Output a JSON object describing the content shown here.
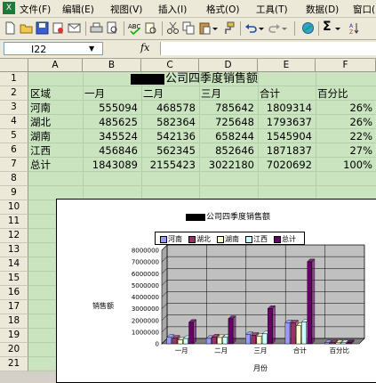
{
  "menu": {
    "items": [
      "文件(F)",
      "编辑(E)",
      "视图(V)",
      "插入(I)",
      "格式(O)",
      "工具(T)",
      "数据(D)",
      "窗口("
    ]
  },
  "formula_bar": {
    "name_box": "I22",
    "fx": "fx",
    "value": ""
  },
  "columns": [
    "A",
    "B",
    "C",
    "D",
    "E",
    "F"
  ],
  "rows": [
    "1",
    "2",
    "3",
    "4",
    "5",
    "6",
    "7",
    "8",
    "9",
    "10",
    "11",
    "12",
    "13",
    "14",
    "15",
    "16",
    "17",
    "18",
    "19",
    "20",
    "21"
  ],
  "sheet": {
    "title_suffix": "公司四季度销售额",
    "header": [
      "区域",
      "一月",
      "二月",
      "三月",
      "合计",
      "百分比"
    ],
    "data": [
      [
        "河南",
        "555094",
        "468578",
        "785642",
        "1809314",
        "26%"
      ],
      [
        "湖北",
        "485625",
        "582364",
        "725648",
        "1793637",
        "26%"
      ],
      [
        "湖南",
        "345524",
        "542136",
        "658244",
        "1545904",
        "22%"
      ],
      [
        "江西",
        "456846",
        "562345",
        "852646",
        "1871837",
        "27%"
      ],
      [
        "总计",
        "1843089",
        "2155423",
        "3022180",
        "7020692",
        "100%"
      ]
    ]
  },
  "chart_data": {
    "type": "bar",
    "title": "公司四季度销售额",
    "xlabel": "月份",
    "ylabel": "销售额",
    "categories": [
      "一月",
      "二月",
      "三月",
      "合计",
      "百分比"
    ],
    "ylim": [
      0,
      8000000
    ],
    "yticks": [
      "8000000",
      "7000000",
      "6000000",
      "5000000",
      "4000000",
      "3000000",
      "2000000",
      "1000000",
      "0"
    ],
    "legend": "top",
    "grid": true,
    "series": [
      {
        "name": "河南",
        "color": "#9999ff",
        "values": [
          555094,
          468578,
          785642,
          1809314,
          0.26
        ]
      },
      {
        "name": "湖北",
        "color": "#993366",
        "values": [
          485625,
          582364,
          725648,
          1793637,
          0.26
        ]
      },
      {
        "name": "湖南",
        "color": "#ffffcc",
        "values": [
          345524,
          542136,
          658244,
          1545904,
          0.22
        ]
      },
      {
        "name": "江西",
        "color": "#ccffff",
        "values": [
          456846,
          562345,
          852646,
          1871837,
          0.27
        ]
      },
      {
        "name": "总计",
        "color": "#660066",
        "values": [
          1843089,
          2155423,
          3022180,
          7020692,
          1
        ]
      }
    ]
  }
}
